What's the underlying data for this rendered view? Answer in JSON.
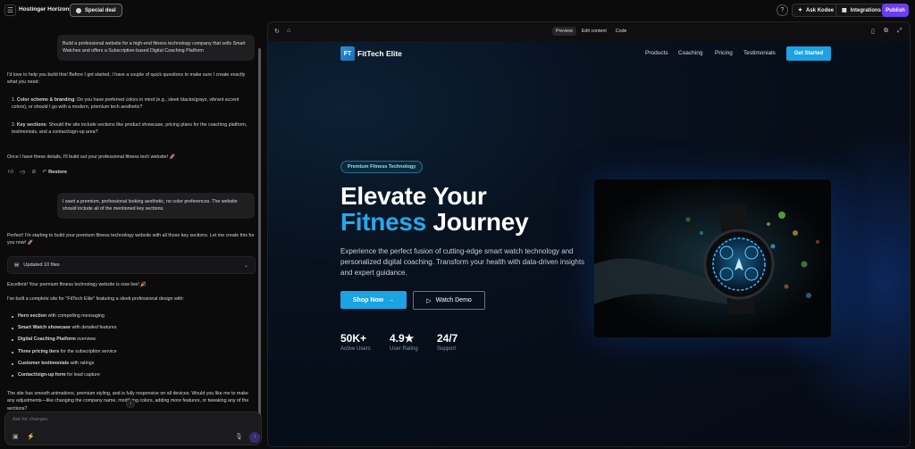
{
  "topbar": {
    "menu_icon": "hamburger-icon",
    "brand": "Hostinger Horizons",
    "deal": "Special deal",
    "help_icon": "question-icon",
    "ask_kodee": "Ask Kodee",
    "integrations": "Integrations",
    "publish": "Publish"
  },
  "chat": {
    "msg1": "Build a professional website for a high-end fitness technology company that sells Smart Watches and offers a Subscription-based Digital Coaching Platform",
    "reply1_intro": "I'd love to help you build this! Before I get started, I have a couple of quick questions to make sure I create exactly what you need:",
    "q1_title": "Color scheme & branding",
    "q1_body": ": Do you have preferred colors in mind (e.g., sleek blacks/grays, vibrant accent colors), or should I go with a modern, premium tech aesthetic?",
    "q2_title": "Key sections",
    "q2_body": ": Should the site include sections like product showcase, pricing plans for the coaching platform, testimonials, and a contact/sign-up area?",
    "reply1_outro": "Once I have these details, I'll build out your professional fitness tech website! 🚀",
    "restore": "Restore",
    "msg2": "I want a premium, professional looking aesthetic, no color preferences. The website should include all of the mentioned key sections.",
    "reply2": "Perfect! I'm starting to build your premium fitness technology website with all those key sections. Let me create this for you now! 🚀",
    "files_label": "Updated 10 files",
    "live": "Excellent! Your premium fitness technology website is now live! 🎉",
    "built": "I've built a complete site for \"FitTech Elite\" featuring a sleek professional design with:",
    "features": [
      {
        "bold": "Hero section",
        "rest": " with compelling messaging"
      },
      {
        "bold": "Smart Watch showcase",
        "rest": " with detailed features"
      },
      {
        "bold": "Digital Coaching Platform",
        "rest": " overview"
      },
      {
        "bold": "Three pricing tiers",
        "rest": " for the subscription service"
      },
      {
        "bold": "Customer testimonials",
        "rest": " with ratings"
      },
      {
        "bold": "Contact/sign-up form",
        "rest": " for lead capture"
      }
    ],
    "closing": "The site has smooth animations, premium styling, and is fully responsive on all devices. Would you like me to make any adjustments—like changing the company name, modifying colors, adding more features, or tweaking any of the sections?",
    "input_placeholder": "Ask for changes"
  },
  "preview": {
    "tabs": [
      "Preview",
      "Edit content",
      "Code"
    ],
    "active_tab": "Preview"
  },
  "site": {
    "logo_mark": "FT",
    "logo_text": "FitTech Elite",
    "nav": [
      "Products",
      "Coaching",
      "Pricing",
      "Testimonials"
    ],
    "cta": "Get Started",
    "pill": "Premium Fitness Technology",
    "h1_line1": "Elevate Your",
    "h1_accent": "Fitness",
    "h1_rest": " Journey",
    "lead": "Experience the perfect fusion of cutting-edge smart watch technology and personalized digital coaching. Transform your health with data-driven insights and expert guidance.",
    "shop_now": "Shop Now",
    "watch_demo": "Watch Demo",
    "stats": [
      {
        "value": "50K+",
        "label": "Active Users"
      },
      {
        "value": "4.9★",
        "label": "User Rating"
      },
      {
        "value": "24/7",
        "label": "Support"
      }
    ]
  },
  "colors": {
    "accent": "#1ba3e3",
    "publish": "#6d3df2",
    "background": "#0b0b0c"
  }
}
